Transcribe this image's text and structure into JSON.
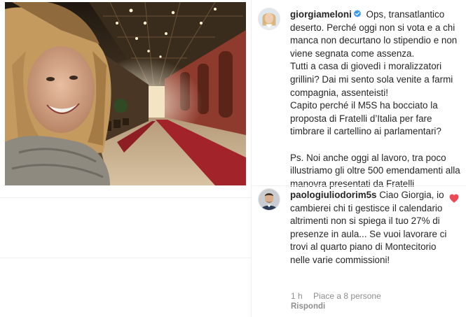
{
  "post": {
    "author": "giorgiameloni",
    "caption_paragraphs": [
      "Ops, transatlantico deserto. Perché oggi non si vota e a chi manca non decurtano lo stipendio e non viene segnata come assenza.",
      "Tutti a casa di giovedì i moralizzatori grillini? Dai mi sento sola venite a farmi compagnia, assenteisti!",
      "Capito perché il M5S ha bocciato la proposta di Fratelli d’Italia per fare timbrare il cartellino ai parlamentari?",
      "Ps. Noi anche oggi al lavoro, tra poco illustriamo gli oltre 500 emendamenti alla manovra presentati da Fratelli"
    ],
    "verified_icon": "verified-badge-icon"
  },
  "comment": {
    "author": "paologiuliodorim5s",
    "text": "Ciao Giorgia, io cambierei chi ti gestisce il calendario altrimenti non si spiega il tuo 27% di presenze in aula... Se vuoi lavorare ci trovi al quarto piano di Montecitorio nelle varie commissioni!",
    "time": "1 h",
    "likes": "Piace a 8 persone",
    "reply_label": "Rispondi",
    "like_icon": "heart-icon",
    "liked": true
  },
  "colors": {
    "text": "#262626",
    "muted": "#8e8e8e",
    "verified": "#3897f0",
    "heart": "#ed4956",
    "divider": "#efefef"
  }
}
